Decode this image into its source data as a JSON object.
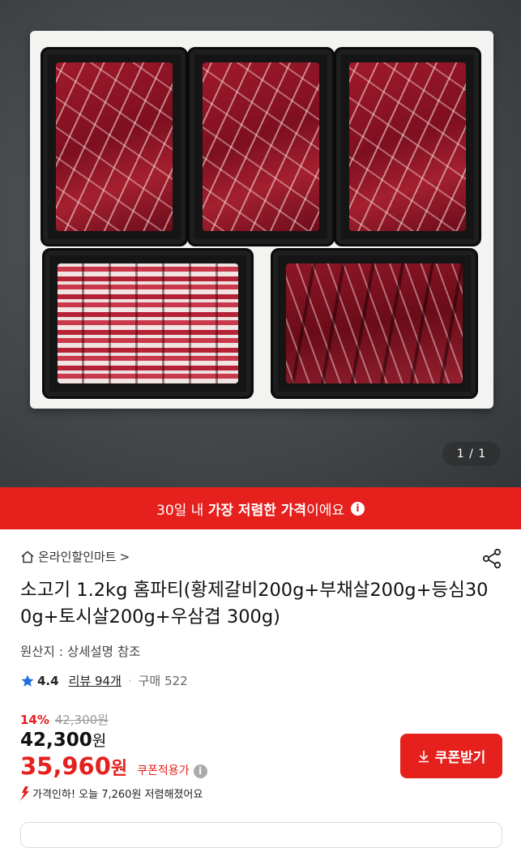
{
  "hero": {
    "counter": "1 / 1"
  },
  "banner": {
    "pre": "30일 내 ",
    "bold": "가장 저렴한 가격",
    "post": "이에요",
    "info_icon": "info-icon"
  },
  "store": {
    "name": "온라인할인마트",
    "chevron": ">"
  },
  "product": {
    "title": "소고기 1.2kg 홈파티(황제갈비200g+부채살200g+등심300g+토시살200g+우삼겹 300g)",
    "origin": "원산지 : 상세설명 참조"
  },
  "rating": {
    "score": "4.4",
    "review": "리뷰 94개",
    "separator": "·",
    "purchase": "구매 522"
  },
  "pricing": {
    "discount_pct": "14%",
    "original_price": "42,300원",
    "price": "42,300",
    "price_unit": "원",
    "coupon_price": "35,960",
    "coupon_unit": "원",
    "coupon_label": "쿠폰적용가",
    "drop_notice": "가격인하! 오늘 7,260원 저렴해졌어요"
  },
  "coupon_button": {
    "label": "쿠폰받기"
  },
  "colors": {
    "accent": "#e5201d",
    "star": "#1e6fe0"
  }
}
